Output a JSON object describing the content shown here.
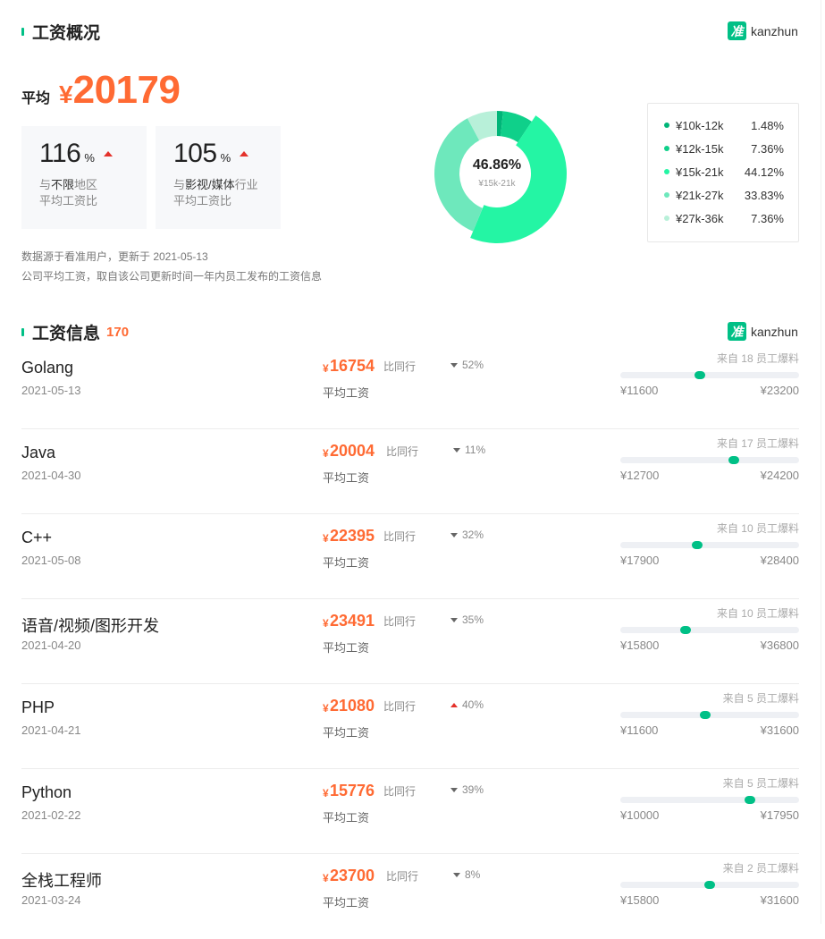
{
  "overview": {
    "title": "工资概况",
    "brand": {
      "logo": "准",
      "name": "kanzhun"
    },
    "average_label": "平均",
    "currency": "¥",
    "average_value": "20179",
    "compare_cards": [
      {
        "value": "116",
        "unit": "%",
        "trend": "up",
        "line1_prefix": "与",
        "line1_highlight": "不限",
        "line1_suffix": "地区",
        "line2": "平均工资比"
      },
      {
        "value": "105",
        "unit": "%",
        "trend": "up",
        "line1_prefix": "与",
        "line1_highlight": "影视/媒体",
        "line1_suffix": "行业",
        "line2": "平均工资比"
      }
    ],
    "note_line1": "数据源于看准用户，更新于 2021-05-13",
    "note_line2": "公司平均工资，取自该公司更新时间一年内员工发布的工资信息",
    "donut_center_value": "46.86%",
    "donut_center_label": "¥15k-21k",
    "distribution": [
      {
        "range": "¥10k-12k",
        "percent": "1.48%",
        "value": 1.48,
        "color": "#00b578"
      },
      {
        "range": "¥12k-15k",
        "percent": "7.36%",
        "value": 7.36,
        "color": "#0fd08a"
      },
      {
        "range": "¥15k-21k",
        "percent": "44.12%",
        "value": 44.12,
        "color": "#24f5a4"
      },
      {
        "range": "¥21k-27k",
        "percent": "33.83%",
        "value": 33.83,
        "color": "#6ee8bc"
      },
      {
        "range": "¥27k-36k",
        "percent": "7.36%",
        "value": 7.36,
        "color": "#b8f0d9"
      }
    ]
  },
  "salary_info": {
    "title": "工资信息",
    "count": "170",
    "brand": {
      "logo": "准",
      "name": "kanzhun"
    },
    "compare_label": "比同行",
    "avg_label": "平均工资",
    "currency": "¥",
    "jobs": [
      {
        "name": "Golang",
        "date": "2021-05-13",
        "amount": "16754",
        "trend": "down",
        "diff": "52%",
        "source": "来自 18 员工爆料",
        "min": "¥11600",
        "max": "¥23200",
        "min_v": 11600,
        "max_v": 23200,
        "avg_v": 16754
      },
      {
        "name": "Java",
        "date": "2021-04-30",
        "amount": "20004",
        "trend": "down",
        "diff": "11%",
        "source": "来自 17 员工爆料",
        "min": "¥12700",
        "max": "¥24200",
        "min_v": 12700,
        "max_v": 24200,
        "avg_v": 20004
      },
      {
        "name": "C++",
        "date": "2021-05-08",
        "amount": "22395",
        "trend": "down",
        "diff": "32%",
        "source": "来自 10 员工爆料",
        "min": "¥17900",
        "max": "¥28400",
        "min_v": 17900,
        "max_v": 28400,
        "avg_v": 22395
      },
      {
        "name": "语音/视频/图形开发",
        "date": "2021-04-20",
        "amount": "23491",
        "trend": "down",
        "diff": "35%",
        "source": "来自 10 员工爆料",
        "min": "¥15800",
        "max": "¥36800",
        "min_v": 15800,
        "max_v": 36800,
        "avg_v": 23491
      },
      {
        "name": "PHP",
        "date": "2021-04-21",
        "amount": "21080",
        "trend": "up",
        "diff": "40%",
        "source": "来自 5 员工爆料",
        "min": "¥11600",
        "max": "¥31600",
        "min_v": 11600,
        "max_v": 31600,
        "avg_v": 21080
      },
      {
        "name": "Python",
        "date": "2021-02-22",
        "amount": "15776",
        "trend": "down",
        "diff": "39%",
        "source": "来自 5 员工爆料",
        "min": "¥10000",
        "max": "¥17950",
        "min_v": 10000,
        "max_v": 17950,
        "avg_v": 15776
      },
      {
        "name": "全栈工程师",
        "date": "2021-03-24",
        "amount": "23700",
        "trend": "down",
        "diff": "8%",
        "source": "来自 2 员工爆料",
        "min": "¥15800",
        "max": "¥31600",
        "min_v": 15800,
        "max_v": 31600,
        "avg_v": 23700
      }
    ]
  }
}
